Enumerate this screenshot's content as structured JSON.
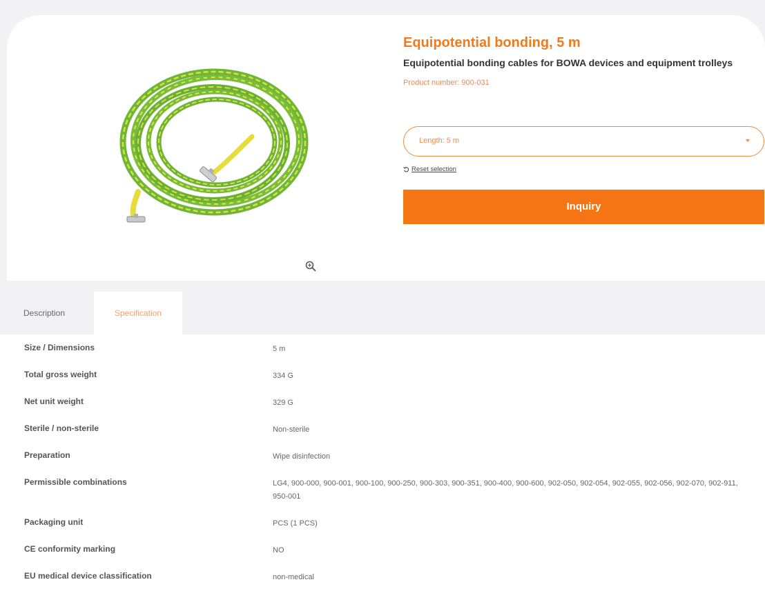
{
  "product": {
    "title": "Equipotential bonding, 5 m",
    "subtitle": "Equipotential bonding cables for BOWA devices and equipment trolleys",
    "product_number": "Product number: 900-031",
    "image_icon": "coiled-green-yellow-cable-image",
    "zoom_icon": "magnifier-plus-icon"
  },
  "selector": {
    "value": "Length: 5 m",
    "icon": "caret-down-icon"
  },
  "reset": {
    "label": "Reset selection",
    "icon": "undo-icon"
  },
  "inquiry": {
    "label": "Inquiry"
  },
  "tabs": [
    {
      "label": "Description",
      "active": false
    },
    {
      "label": "Specification",
      "active": true
    }
  ],
  "specs": [
    {
      "label": "Size / Dimensions",
      "value": "5 m"
    },
    {
      "label": "Total gross weight",
      "value": "334 G"
    },
    {
      "label": "Net unit weight",
      "value": "329 G"
    },
    {
      "label": "Sterile / non-sterile",
      "value": "Non-sterile"
    },
    {
      "label": "Preparation",
      "value": "Wipe disinfection"
    },
    {
      "label": "Permissible combinations",
      "value": "LG4, 900-000, 900-001, 900-100, 900-250, 900-303, 900-351, 900-400, 900-600, 902-050, 902-054, 902-055, 902-056, 902-070, 902-911, 950-001"
    },
    {
      "label": "Packaging unit",
      "value": "PCS (1 PCS)"
    },
    {
      "label": "CE conformity marking",
      "value": "NO"
    },
    {
      "label": "EU medical device classification",
      "value": "non-medical"
    }
  ],
  "colors": {
    "accent": "#f57414",
    "title": "#f27a1a",
    "cable_green": "#7cbf3a",
    "cable_yellow": "#e3df3a"
  }
}
